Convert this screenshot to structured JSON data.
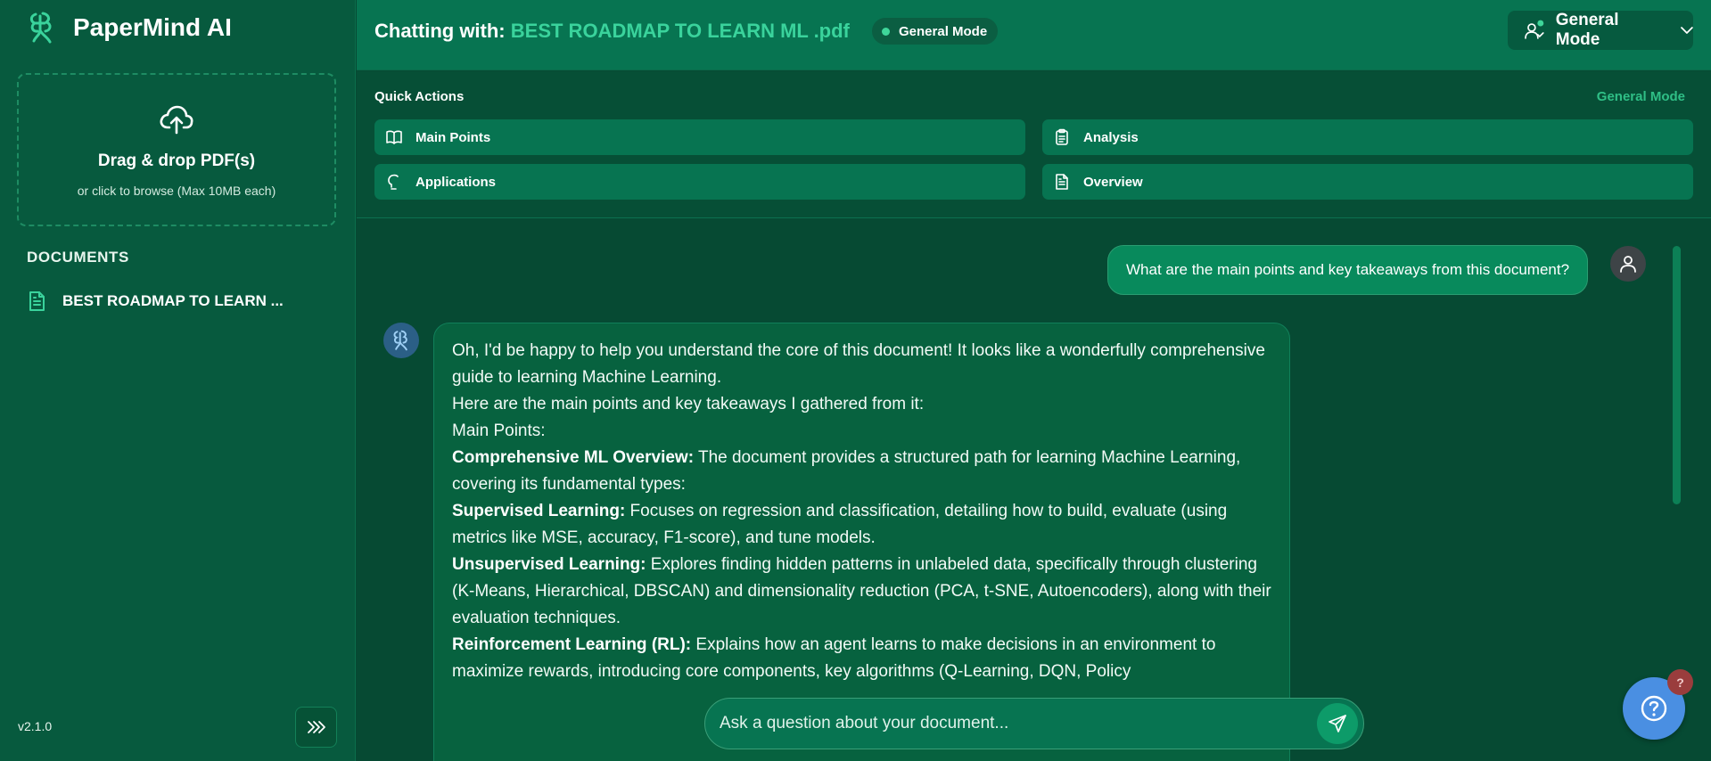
{
  "app": {
    "name": "PaperMind AI",
    "version": "v2.1.0"
  },
  "sidebar": {
    "upload": {
      "title": "Drag & drop PDF(s)",
      "subtitle": "or click to browse (Max 10MB each)"
    },
    "documents_heading": "DOCUMENTS",
    "documents": [
      {
        "label": "BEST ROADMAP TO LEARN ..."
      }
    ]
  },
  "header": {
    "chat_prefix": "Chatting with:",
    "file_name": "BEST ROADMAP TO LEARN ML .pdf",
    "mode_badge": "General Mode",
    "mode_select": "General Mode"
  },
  "quick_actions": {
    "heading": "Quick Actions",
    "mode_label": "General Mode",
    "items": [
      {
        "label": "Main Points",
        "icon": "book-open-icon"
      },
      {
        "label": "Analysis",
        "icon": "clipboard-icon"
      },
      {
        "label": "Applications",
        "icon": "lightbulb-icon"
      },
      {
        "label": "Overview",
        "icon": "file-text-icon"
      }
    ]
  },
  "chat": {
    "user_message": "What are the main points and key takeaways from this document?",
    "bot_message": {
      "intro1": "Oh, I'd be happy to help you understand the core of this document! It looks like a wonderfully comprehensive guide to learning Machine Learning.",
      "intro2": "Here are the main points and key takeaways I gathered from it:",
      "section": "Main Points:",
      "points": [
        {
          "title": "Comprehensive ML Overview:",
          "text": " The document provides a structured path for learning Machine Learning, covering its fundamental types:"
        },
        {
          "title": "Supervised Learning:",
          "text": " Focuses on regression and classification, detailing how to build, evaluate (using metrics like MSE, accuracy, F1-score), and tune models."
        },
        {
          "title": "Unsupervised Learning:",
          "text": " Explores finding hidden patterns in unlabeled data, specifically through clustering (K-Means, Hierarchical, DBSCAN) and dimensionality reduction (PCA, t-SNE, Autoencoders), along with their evaluation techniques."
        },
        {
          "title": "Reinforcement Learning (RL):",
          "text": " Explains how an agent learns to make decisions in an environment to maximize rewards, introducing core components, key algorithms (Q-Learning, DQN, Policy"
        }
      ]
    }
  },
  "input": {
    "placeholder": "Ask a question about your document..."
  },
  "help": {
    "badge": "?"
  },
  "colors": {
    "sidebar_bg": "#075a3e",
    "header_bg": "#077451",
    "accent": "#3ad39c",
    "help_blue": "#4a8fe2",
    "help_badge": "#9a3d3d"
  }
}
